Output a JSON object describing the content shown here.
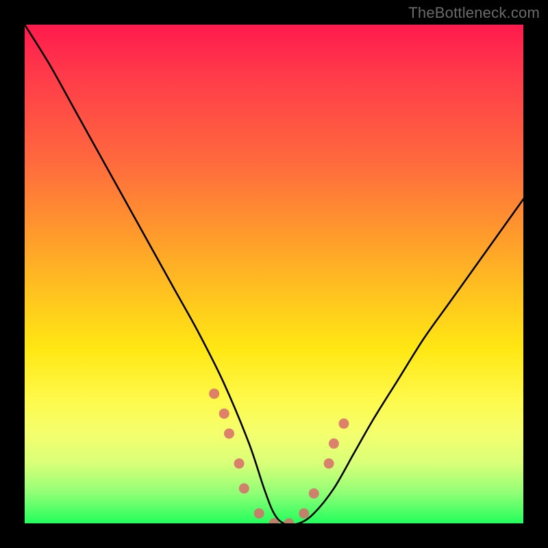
{
  "watermark": "TheBottleneck.com",
  "chart_data": {
    "type": "line",
    "title": "",
    "xlabel": "",
    "ylabel": "",
    "xlim": [
      0,
      100
    ],
    "ylim": [
      0,
      100
    ],
    "x": [
      0,
      5,
      10,
      15,
      20,
      25,
      30,
      35,
      40,
      45,
      48,
      50,
      52,
      55,
      58,
      62,
      66,
      70,
      75,
      80,
      85,
      90,
      95,
      100
    ],
    "values": [
      100,
      92,
      83,
      74,
      65,
      56,
      47,
      38,
      28,
      16,
      7,
      2,
      0,
      0,
      2,
      7,
      14,
      21,
      29,
      37,
      44,
      51,
      58,
      65
    ],
    "markers": {
      "type": "scatter",
      "color": "#d86b6b",
      "points_x": [
        38,
        40,
        41,
        43,
        44,
        47,
        50,
        53,
        56,
        58,
        61,
        62,
        64
      ],
      "points_y": [
        26,
        22,
        18,
        12,
        7,
        2,
        0,
        0,
        2,
        6,
        12,
        16,
        20
      ]
    },
    "background_gradient": [
      "#ff1a4d",
      "#ff9a2c",
      "#fff94a",
      "#22ff5c"
    ]
  }
}
